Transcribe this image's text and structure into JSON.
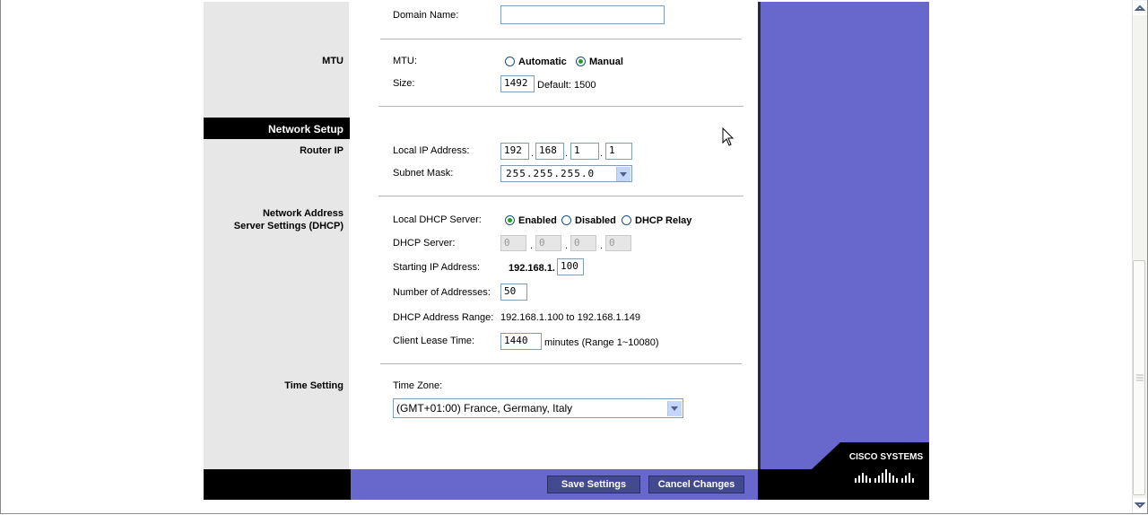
{
  "sections": {
    "mtu": "MTU",
    "network_setup": "Network Setup",
    "router_ip": "Router IP",
    "dhcp_line1": "Network Address",
    "dhcp_line2": "Server Settings (DHCP)",
    "time_setting": "Time Setting"
  },
  "domain": {
    "label": "Domain Name:",
    "value": ""
  },
  "mtu": {
    "label": "MTU:",
    "automatic": "Automatic",
    "manual": "Manual",
    "selected": "Manual",
    "size_label": "Size:",
    "size_value": "1492",
    "default_text": "Default: 1500"
  },
  "router_ip": {
    "local_ip_label": "Local IP Address:",
    "ip1": "192",
    "ip2": "168",
    "ip3": "1",
    "ip4": "1",
    "subnet_label": "Subnet Mask:",
    "subnet_value": "255.255.255.0"
  },
  "dhcp": {
    "server_label": "Local DHCP Server:",
    "enabled": "Enabled",
    "disabled": "Disabled",
    "relay": "DHCP Relay",
    "selected": "Enabled",
    "dhcp_server_label": "DHCP Server:",
    "srv1": "0",
    "srv2": "0",
    "srv3": "0",
    "srv4": "0",
    "start_label": "Starting IP Address:",
    "start_prefix": "192.168.1.",
    "start_value": "100",
    "num_label": "Number of Addresses:",
    "num_value": "50",
    "range_label": "DHCP Address Range:",
    "range_value": "192.168.1.100 to 192.168.1.149",
    "lease_label": "Client Lease Time:",
    "lease_value": "1440",
    "lease_suffix": "minutes (Range 1~10080)"
  },
  "time": {
    "zone_label": "Time Zone:",
    "zone_value": "(GMT+01:00) France, Germany, Italy"
  },
  "buttons": {
    "save": "Save Settings",
    "cancel": "Cancel Changes"
  },
  "brand": {
    "logo_text": "Cisco Systems"
  },
  "colors": {
    "accent_purple": "#6767cc",
    "button": "#434a8f",
    "radio_on": "#21a121"
  }
}
